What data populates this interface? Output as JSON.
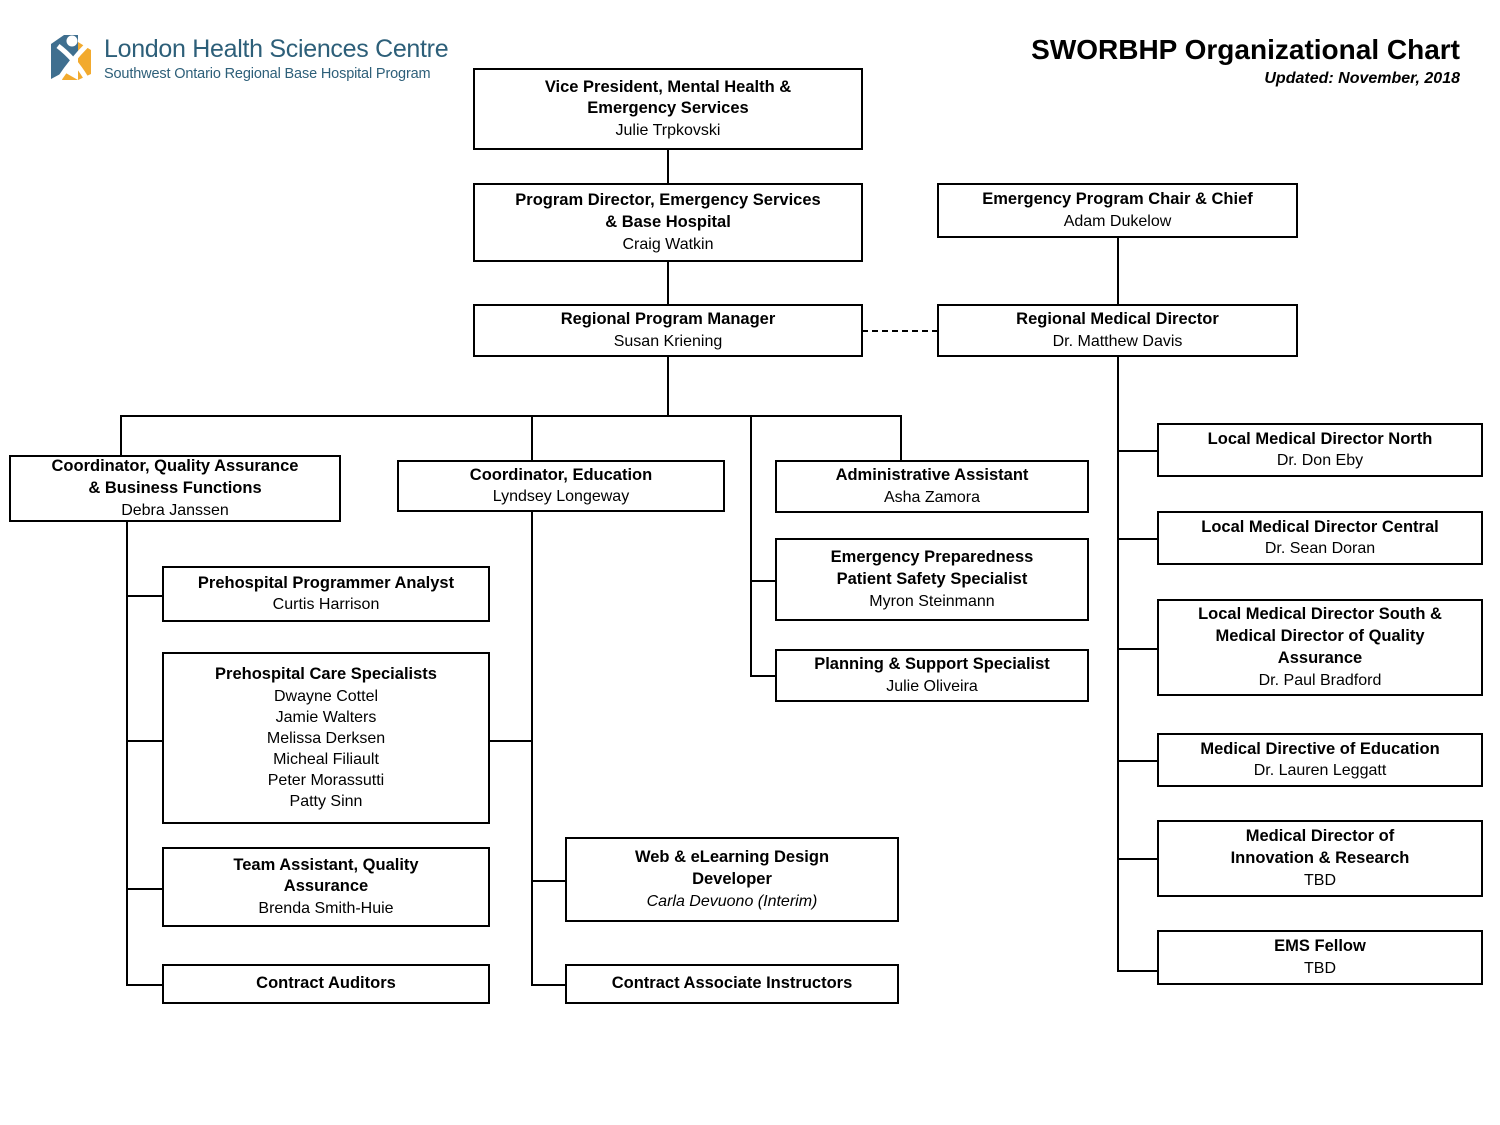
{
  "header": {
    "logo": {
      "icon": "lhsc-logo-icon",
      "title": "London Health Sciences Centre",
      "subtitle": "Southwest Ontario Regional Base Hospital Program",
      "brand_blue": "#2d5f79",
      "brand_gold": "#f2aa2e"
    },
    "chart_title": "SWORBHP Organizational Chart",
    "updated": "Updated: November, 2018"
  },
  "nodes": {
    "vp": {
      "title": "Vice President, Mental Health &\nEmergency Services",
      "name": "Julie Trpkovski"
    },
    "program_director": {
      "title": "Program Director, Emergency Services\n& Base Hospital",
      "name": "Craig Watkin"
    },
    "emergency_chair": {
      "title": "Emergency Program Chair & Chief",
      "name": "Adam Dukelow"
    },
    "regional_program_manager": {
      "title": "Regional Program Manager",
      "name": "Susan Kriening"
    },
    "regional_medical_director": {
      "title": "Regional Medical Director",
      "name": "Dr. Matthew Davis"
    },
    "coordinator_qa": {
      "title": "Coordinator, Quality Assurance\n& Business Functions",
      "name": "Debra Janssen"
    },
    "programmer_analyst": {
      "title": "Prehospital Programmer Analyst",
      "name": "Curtis Harrison"
    },
    "care_specialists": {
      "title": "Prehospital Care Specialists",
      "name": "Dwayne Cottel\nJamie Walters\nMelissa Derksen\nMicheal Filiault\nPeter Morassutti\nPatty Sinn"
    },
    "team_assistant_qa": {
      "title": "Team Assistant, Quality\nAssurance",
      "name": "Brenda Smith-Huie"
    },
    "contract_auditors": {
      "title": "Contract Auditors",
      "name": ""
    },
    "coordinator_education": {
      "title": "Coordinator, Education",
      "name": "Lyndsey Longeway"
    },
    "web_elearning": {
      "title": "Web & eLearning Design\nDeveloper",
      "name": "Carla Devuono (Interim)"
    },
    "contract_instructors": {
      "title": "Contract Associate Instructors",
      "name": ""
    },
    "admin_assistant": {
      "title": "Administrative Assistant",
      "name": "Asha Zamora"
    },
    "emergency_preparedness": {
      "title": "Emergency Preparedness\nPatient Safety Specialist",
      "name": "Myron Steinmann"
    },
    "planning_support": {
      "title": "Planning & Support Specialist",
      "name": "Julie Oliveira"
    },
    "lmd_north": {
      "title": "Local Medical Director North",
      "name": "Dr. Don Eby"
    },
    "lmd_central": {
      "title": "Local Medical Director Central",
      "name": "Dr. Sean Doran"
    },
    "lmd_south": {
      "title": "Local Medical Director South &\nMedical Director of Quality\nAssurance",
      "name": "Dr. Paul Bradford"
    },
    "medical_directive_education": {
      "title": "Medical Directive of Education",
      "name": "Dr. Lauren Leggatt"
    },
    "medical_director_innovation": {
      "title": "Medical Director of\nInnovation & Research",
      "name": "TBD"
    },
    "ems_fellow": {
      "title": "EMS Fellow",
      "name": "TBD"
    }
  }
}
